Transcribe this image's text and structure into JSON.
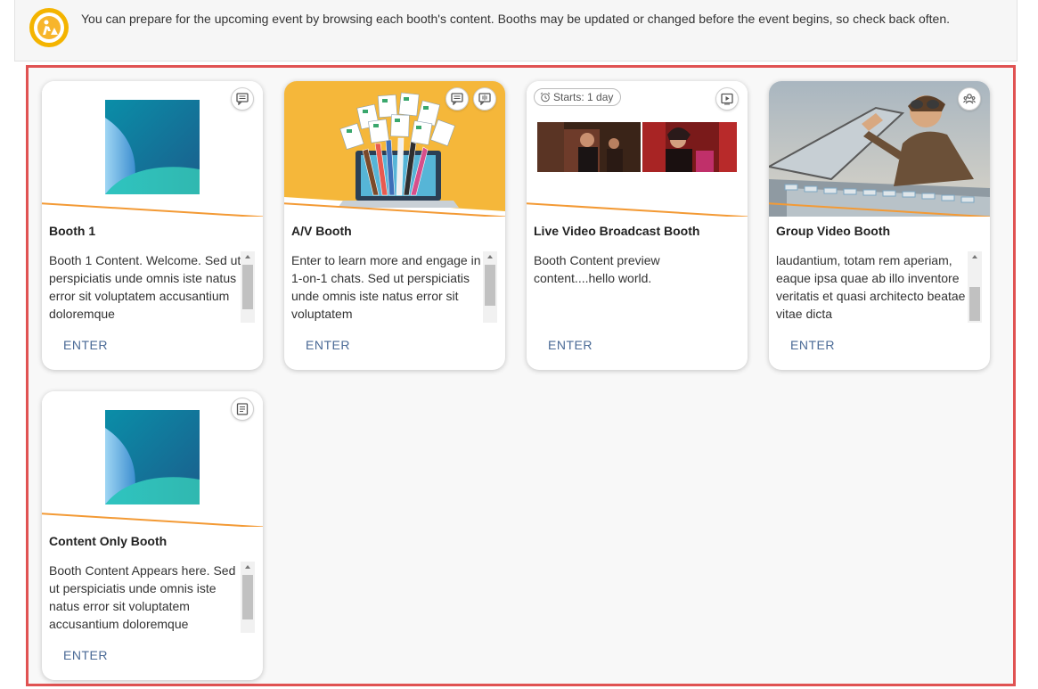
{
  "banner": {
    "text": "You can prepare for the upcoming event by browsing each booth's content. Booths may be updated or changed before the event begins, so check back often."
  },
  "booths": [
    {
      "title": "Booth 1",
      "content": "Booth 1 Content. Welcome. Sed ut perspiciatis unde omnis iste natus error sit voluptatem accusantium doloremque",
      "enter_label": "ENTER",
      "media": "abstract-teal-logo",
      "badges": [
        "chat-icon"
      ]
    },
    {
      "title": "A/V Booth",
      "content": "Enter to learn more and engage in 1-on-1 chats. Sed ut perspiciatis unde omnis iste natus error sit voluptatem",
      "enter_label": "ENTER",
      "media": "laptop-resumes-illustration",
      "badges": [
        "chat-icon",
        "voice-chat-icon"
      ]
    },
    {
      "title": "Live Video Broadcast Booth",
      "content": "Booth Content preview content....hello world.",
      "enter_label": "ENTER",
      "media": "video-stills",
      "starts_label": "Starts: 1 day",
      "badges": [
        "video-icon"
      ]
    },
    {
      "title": "Group Video Booth",
      "content": "laudantium, totam rem aperiam, eaque ipsa quae ab illo inventore veritatis et quasi architecto beatae vitae dicta",
      "enter_label": "ENTER",
      "media": "pilot-photo",
      "badges": [
        "group-icon"
      ]
    },
    {
      "title": "Content Only Booth",
      "content": "Booth Content Appears here. Sed ut perspiciatis unde omnis iste natus error sit voluptatem accusantium doloremque",
      "enter_label": "ENTER",
      "media": "abstract-teal-logo",
      "badges": [
        "document-icon"
      ]
    }
  ],
  "colors": {
    "accent_line": "#f39a35",
    "enter_link": "#4a6a96",
    "selection_border": "#e05252",
    "banner_icon": "#f4b400",
    "av_media_bg": "#f5b73a"
  }
}
